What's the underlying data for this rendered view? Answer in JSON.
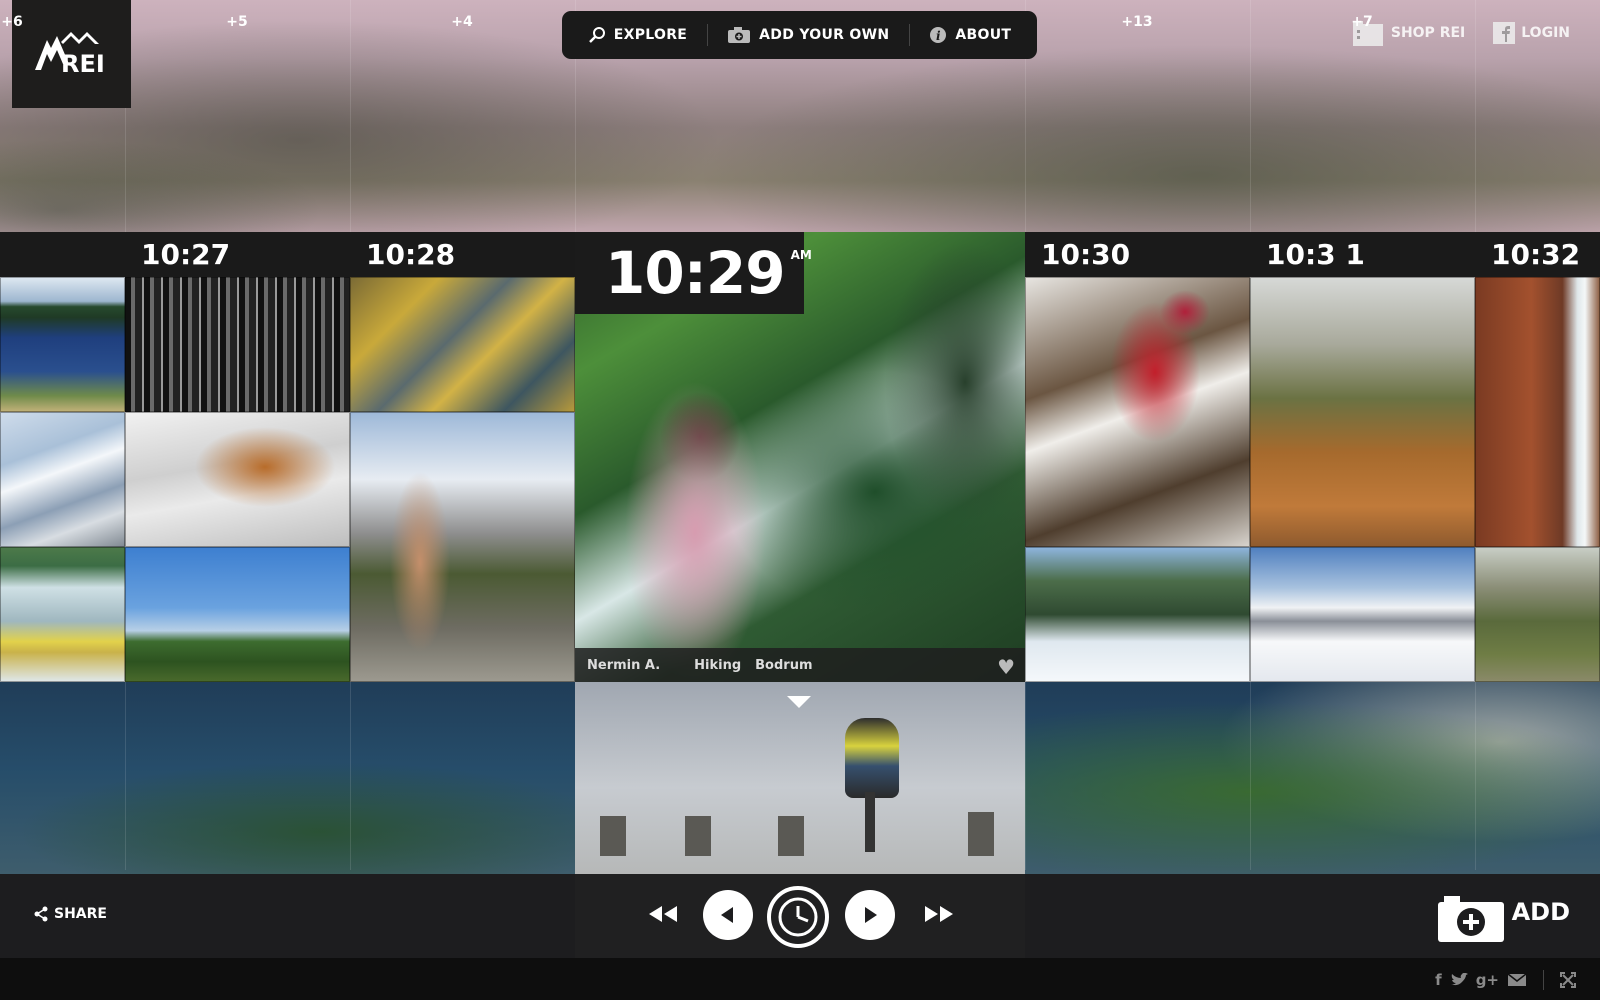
{
  "brand": {
    "logo_text": "REI"
  },
  "topnav": {
    "items": [
      {
        "label": "EXPLORE",
        "icon": "search-icon"
      },
      {
        "label": "ADD YOUR OWN",
        "icon": "camera-icon"
      },
      {
        "label": "ABOUT",
        "icon": "info-icon"
      }
    ]
  },
  "top_right": {
    "shop": {
      "label": "SHOP REI",
      "icon": "store-icon"
    },
    "login": {
      "label": "LOGIN",
      "icon": "facebook-icon"
    }
  },
  "timeline": {
    "columns": [
      {
        "time": "10:27"
      },
      {
        "time": "10:28"
      },
      {
        "time": "10:30"
      },
      {
        "time": "10:3 1"
      },
      {
        "time": "10:32"
      }
    ],
    "featured": {
      "time": "10:29",
      "ampm": "AM",
      "user": "Nermin A.",
      "activity": "Hiking",
      "location": "Bodrum"
    },
    "more_counts": [
      "+6",
      "+5",
      "+4",
      "+13",
      "+7"
    ]
  },
  "controls": {
    "share_label": "SHARE",
    "add_label": "ADD"
  },
  "footer": {
    "social": [
      "f",
      "t",
      "g+",
      "mail",
      "fullscreen"
    ]
  },
  "colors": {
    "bar": "#1a1a1a",
    "hero_top": "#cdb2bd",
    "counts_band": "#264d6a"
  }
}
